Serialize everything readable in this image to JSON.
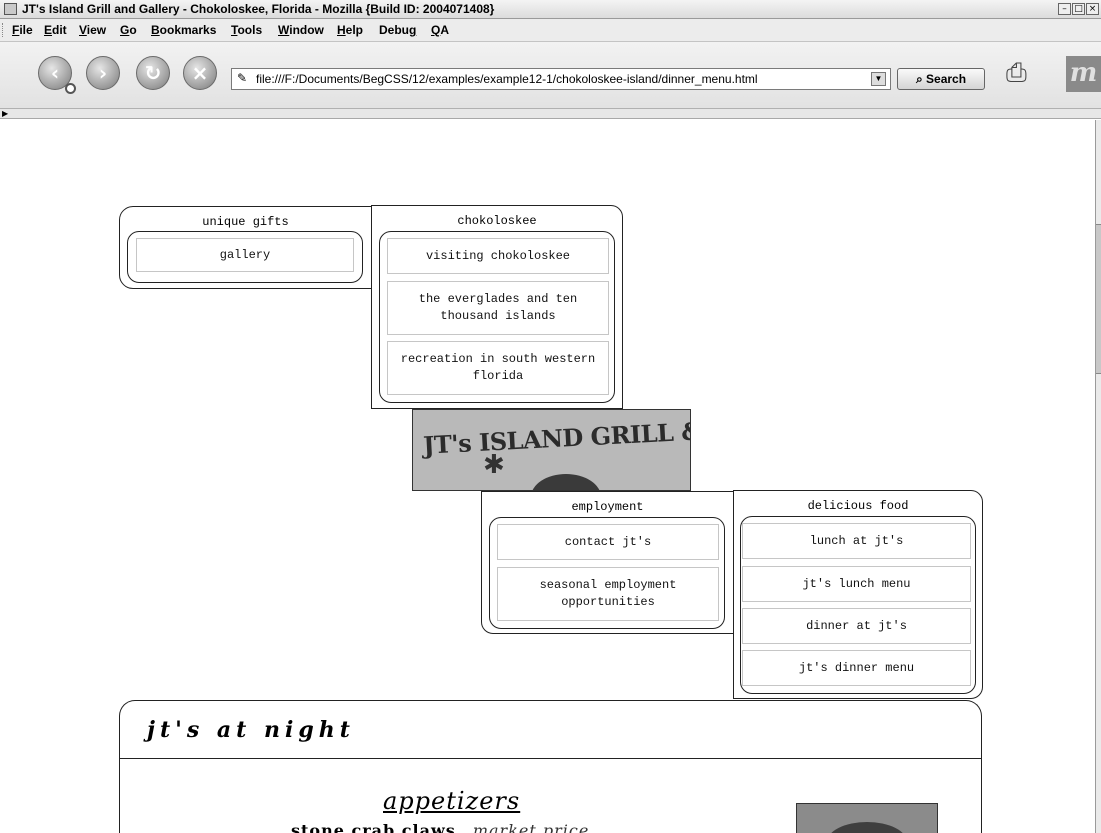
{
  "window": {
    "title": "JT's Island Grill and Gallery - Chokoloskee, Florida - Mozilla {Build ID: 2004071408}",
    "controls": [
      "minimize",
      "maximize",
      "close"
    ]
  },
  "menubar": {
    "items": [
      {
        "u": "F",
        "rest": "ile"
      },
      {
        "u": "E",
        "rest": "dit"
      },
      {
        "u": "V",
        "rest": "iew"
      },
      {
        "u": "G",
        "rest": "o"
      },
      {
        "u": "B",
        "rest": "ookmarks"
      },
      {
        "u": "T",
        "rest": "ools"
      },
      {
        "u": "W",
        "rest": "indow"
      },
      {
        "u": "H",
        "rest": "elp"
      },
      {
        "pre": "Debu",
        "u": "g",
        "rest": ""
      },
      {
        "u": "Q",
        "rest": "A"
      }
    ]
  },
  "navbar": {
    "back_icon": "back-icon",
    "forward_icon": "forward-icon",
    "reload_icon": "reload-icon",
    "stop_icon": "stop-icon",
    "url": "file:///F:/Documents/BegCSS/12/examples/example12-1/chokoloskee-island/dinner_menu.html",
    "search_label": "Search"
  },
  "page": {
    "unique_gifts": {
      "heading": "unique gifts",
      "links": [
        "gallery"
      ]
    },
    "chokoloskee": {
      "heading": "chokoloskee",
      "links": [
        "visiting chokoloskee",
        "the everglades and ten thousand islands",
        "recreation in south western florida"
      ]
    },
    "logo": {
      "text": "JT's ISLAND GRILL & GALLERY"
    },
    "employment": {
      "heading": "employment",
      "links": [
        "contact jt's",
        "seasonal employment opportunities"
      ]
    },
    "delicious_food": {
      "heading": "delicious food",
      "links": [
        "lunch at jt's",
        "jt's lunch menu",
        "dinner at jt's",
        "jt's dinner menu"
      ]
    },
    "night": {
      "title": "jt's at night",
      "section": "appetizers",
      "first_item": "stone crab claws",
      "first_price": "market price"
    }
  }
}
